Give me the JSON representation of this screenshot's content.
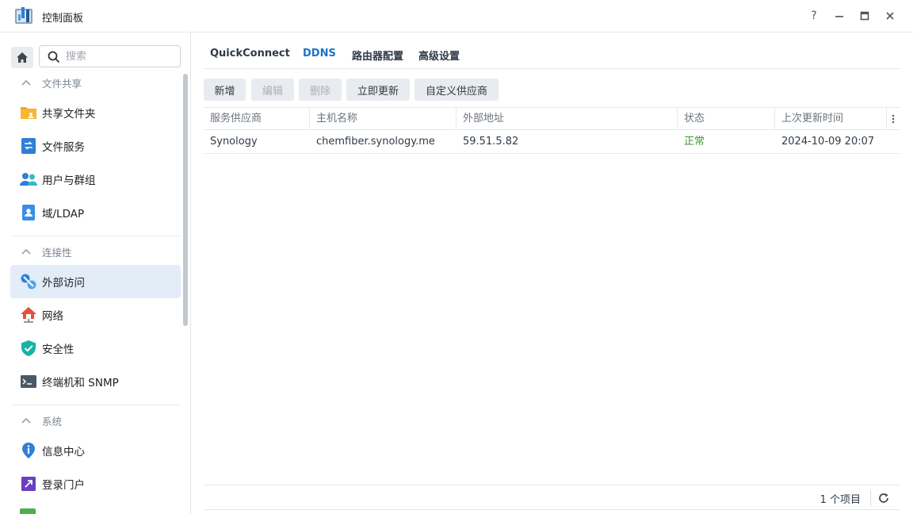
{
  "window": {
    "title": "控制面板",
    "help_label": "?",
    "controls": [
      "help",
      "minimize",
      "maximize",
      "close"
    ]
  },
  "sidebar": {
    "search_placeholder": "搜索",
    "sections": [
      {
        "title": "文件共享",
        "items": [
          {
            "label": "共享文件夹",
            "icon": "folder-share-icon"
          },
          {
            "label": "文件服务",
            "icon": "file-services-icon"
          },
          {
            "label": "用户与群组",
            "icon": "users-icon"
          },
          {
            "label": "域/LDAP",
            "icon": "ldap-icon"
          }
        ]
      },
      {
        "title": "连接性",
        "items": [
          {
            "label": "外部访问",
            "icon": "external-access-icon",
            "active": true
          },
          {
            "label": "网络",
            "icon": "network-icon"
          },
          {
            "label": "安全性",
            "icon": "security-shield-icon"
          },
          {
            "label": "终端机和 SNMP",
            "icon": "terminal-icon"
          }
        ]
      },
      {
        "title": "系统",
        "items": [
          {
            "label": "信息中心",
            "icon": "info-center-icon"
          },
          {
            "label": "登录门户",
            "icon": "login-portal-icon"
          }
        ]
      }
    ]
  },
  "tabs": [
    {
      "label": "QuickConnect",
      "active": false
    },
    {
      "label": "DDNS",
      "active": true
    },
    {
      "label": "路由器配置",
      "active": false
    },
    {
      "label": "高级设置",
      "active": false
    }
  ],
  "toolbar": {
    "add": "新增",
    "edit": "编辑",
    "delete": "删除",
    "update_now": "立即更新",
    "custom_provider": "自定义供应商"
  },
  "table": {
    "columns": [
      "服务供应商",
      "主机名称",
      "外部地址",
      "状态",
      "上次更新时间"
    ],
    "rows": [
      {
        "provider": "Synology",
        "hostname": "chemfiber.synology.me",
        "external_address": "59.51.5.82",
        "status": "正常",
        "last_update": "2024-10-09 20:07"
      }
    ]
  },
  "footer": {
    "count": "1 个项目"
  },
  "colors": {
    "accent": "#1a73c8",
    "status_ok": "#3d9a32",
    "active_bg": "#e3edf8"
  }
}
